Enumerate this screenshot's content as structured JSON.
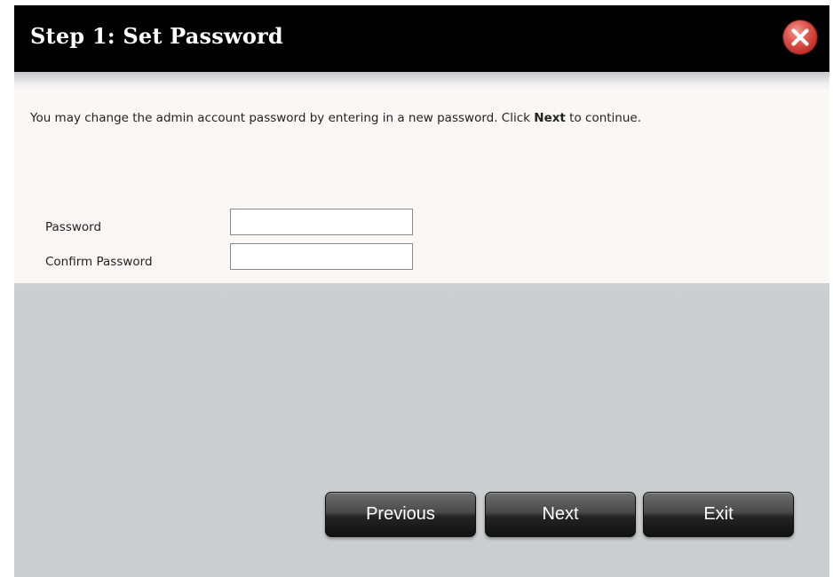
{
  "dialog": {
    "title": "Step 1: Set Password",
    "close_icon": "close-icon"
  },
  "description": {
    "before": "You may change the admin account password by entering in a new password. Click ",
    "bold": "Next",
    "after": " to continue."
  },
  "form": {
    "password_label": "Password",
    "password_value": "",
    "confirm_label": "Confirm Password",
    "confirm_value": ""
  },
  "buttons": {
    "previous": "Previous",
    "next": "Next",
    "exit": "Exit"
  },
  "colors": {
    "titlebar": "#000000",
    "close_button": "#d9453c",
    "content_background": "#fbf7f7",
    "button": "#2a2a2a"
  }
}
